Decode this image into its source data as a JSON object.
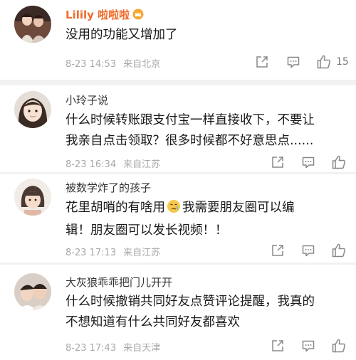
{
  "comments": [
    {
      "name": "Lilily 啦啦啦",
      "text_lines": [
        "没用的功能又增加了"
      ],
      "date": "8-23 14:53",
      "source": "来自北京",
      "likes": "15"
    },
    {
      "name": "小玲子说",
      "text_lines": [
        "什么时候转账跟支付宝一样直接收下，不要让",
        "我亲自点击领取？很多时候都不好意思点......"
      ],
      "date": "8-23 16:34",
      "source": "来自江苏"
    },
    {
      "name": "被数学炸了的孩子",
      "text_lines_pre": "花里胡哨的有啥用",
      "text_lines_post": "我需要朋友圈可以编",
      "text_line2": "辑！朋友圈可以发长视频！！",
      "date": "8-23 17:13",
      "source": "来自江苏"
    },
    {
      "name": "大灰狼乖乖把门儿开开",
      "text_lines": [
        "什么时候撤销共同好友点赞评论提醒，我真的",
        "不想知道有什么共同好友都喜欢"
      ],
      "date": "8-23 17:43",
      "source": "来自天津"
    }
  ]
}
